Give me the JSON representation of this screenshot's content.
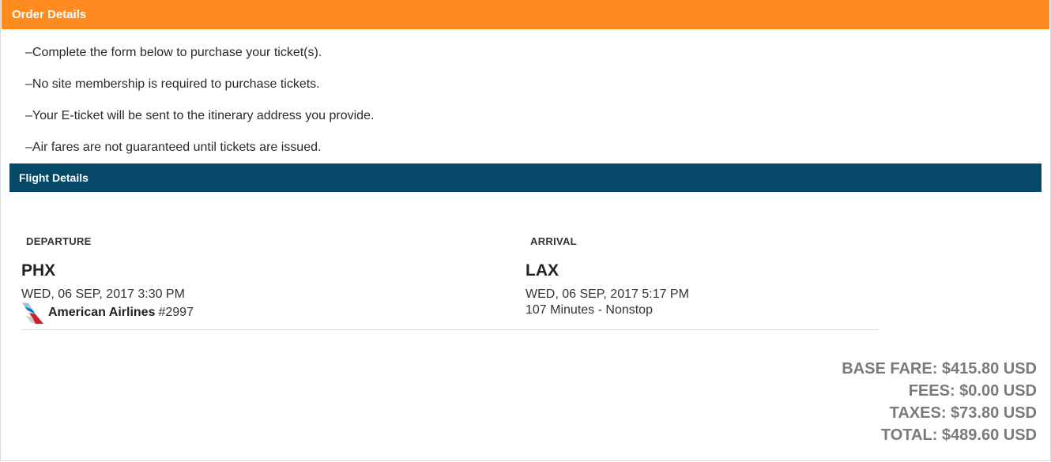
{
  "order": {
    "title": "Order Details",
    "notes": [
      "–Complete the form below to purchase your ticket(s).",
      "–No site membership is required to purchase tickets.",
      "–Your E-ticket will be sent to the itinerary address you provide.",
      "–Air fares are not guaranteed until tickets are issued."
    ]
  },
  "flight": {
    "title": "Flight Details",
    "departure": {
      "label": "DEPARTURE",
      "airport": "PHX",
      "datetime": "WED, 06 SEP, 2017 3:30 PM",
      "airline": "American Airlines",
      "flight_number": "#2997",
      "airline_icon": "american-airlines-logo-icon"
    },
    "arrival": {
      "label": "ARRIVAL",
      "airport": "LAX",
      "datetime": "WED, 06 SEP, 2017 5:17 PM",
      "duration": "107 Minutes - Nonstop"
    }
  },
  "pricing": {
    "base_fare": "BASE FARE: $415.80 USD",
    "fees": "FEES: $0.00 USD",
    "taxes": "TAXES: $73.80 USD",
    "total": "TOTAL: $489.60 USD"
  },
  "colors": {
    "order_header_bg": "#ff8a1f",
    "flight_header_bg": "#054867",
    "totals_text": "#7a7a7a"
  }
}
